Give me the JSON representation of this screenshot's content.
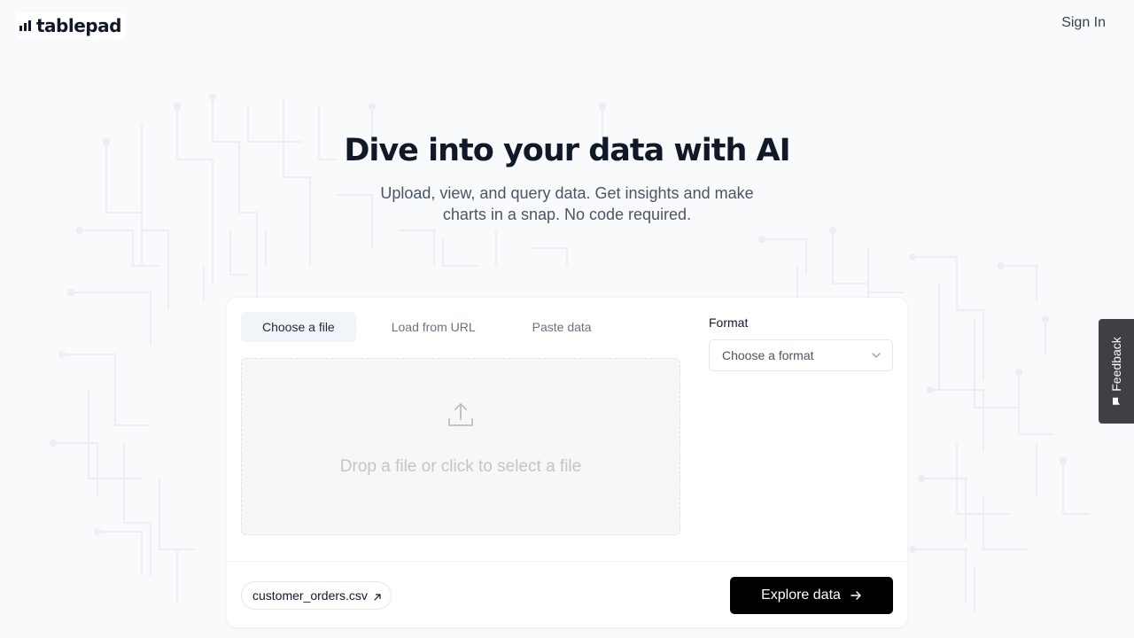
{
  "header": {
    "logo_text": "tablepad",
    "signin_label": "Sign In"
  },
  "hero": {
    "title": "Dive into your data with AI",
    "subtitle": "Upload, view, and query data. Get insights and make charts in a snap. No code required."
  },
  "upload": {
    "tabs": [
      {
        "label": "Choose a file",
        "active": true
      },
      {
        "label": "Load from URL",
        "active": false
      },
      {
        "label": "Paste data",
        "active": false
      }
    ],
    "dropzone_text": "Drop a file or click to select a file",
    "format_label": "Format",
    "format_placeholder": "Choose a format",
    "sample_file": "customer_orders.csv",
    "explore_label": "Explore data"
  },
  "feedback": {
    "label": "Feedback"
  },
  "icons": {
    "logo": "bar-chart-icon",
    "upload": "upload-icon",
    "chevron": "chevron-down-icon",
    "external": "arrow-up-right-icon",
    "arrow": "arrow-right-icon",
    "feedback": "chat-icon"
  },
  "colors": {
    "background": "#f8fafc",
    "primary_button": "#000000",
    "feedback_tab": "#3f3f46"
  }
}
